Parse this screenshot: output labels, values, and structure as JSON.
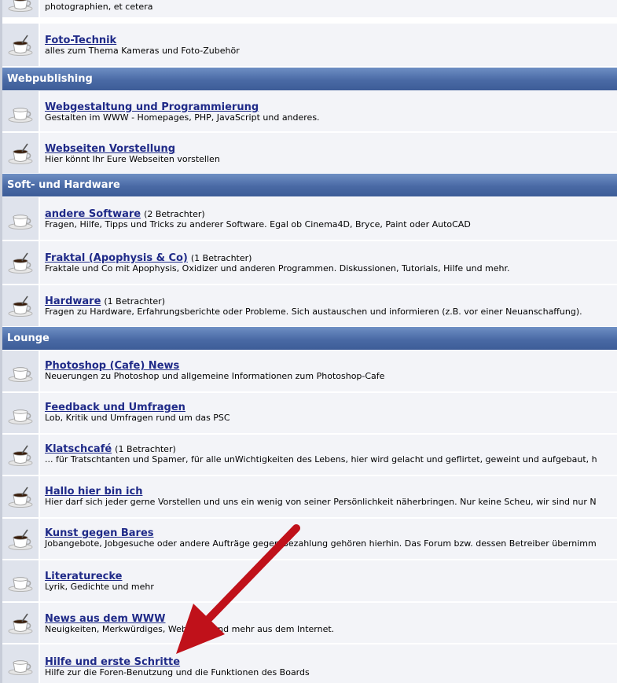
{
  "categories": [
    {
      "name": "Webpublishing"
    },
    {
      "name": "Soft- und Hardware"
    },
    {
      "name": "Lounge"
    }
  ],
  "forums": [
    {
      "title": "",
      "viewers": "",
      "desc": "photographien, et cetera",
      "icon": "cup-full-icon"
    },
    {
      "title": "Foto-Technik",
      "viewers": "",
      "desc": "alles zum Thema Kameras und Foto-Zubehör",
      "icon": "cup-full-icon"
    },
    {
      "title": "Webgestaltung und Programmierung",
      "viewers": "",
      "desc": "Gestalten im WWW - Homepages, PHP, JavaScript und anderes.",
      "icon": "cup-empty-icon"
    },
    {
      "title": "Webseiten Vorstellung",
      "viewers": "",
      "desc": "Hier könnt Ihr Eure Webseiten vorstellen",
      "icon": "cup-full-icon"
    },
    {
      "title": "andere Software",
      "viewers": "(2 Betrachter)",
      "desc": "Fragen, Hilfe, Tipps und Tricks zu anderer Software. Egal ob Cinema4D, Bryce, Paint oder AutoCAD",
      "icon": "cup-empty-icon"
    },
    {
      "title": "Fraktal (Apophysis & Co)",
      "viewers": "(1 Betrachter)",
      "desc": "Fraktale und Co mit Apophysis, Oxidizer und anderen Programmen. Diskussionen, Tutorials, Hilfe und mehr.",
      "icon": "cup-full-icon"
    },
    {
      "title": "Hardware",
      "viewers": "(1 Betrachter)",
      "desc": "Fragen zu Hardware, Erfahrungsberichte oder Probleme. Sich austauschen und informieren (z.B. vor einer Neuanschaffung).",
      "icon": "cup-full-icon"
    },
    {
      "title": "Photoshop (Cafe) News",
      "viewers": "",
      "desc": "Neuerungen zu Photoshop und allgemeine Informationen zum Photoshop-Cafe",
      "icon": "cup-empty-icon"
    },
    {
      "title": "Feedback und Umfragen",
      "viewers": "",
      "desc": "Lob, Kritik und Umfragen rund um das PSC",
      "icon": "cup-empty-icon"
    },
    {
      "title": "Klatschcafé",
      "viewers": "(1 Betrachter)",
      "desc": "... für Tratschtanten und Spamer, für alle unWichtigkeiten des Lebens, hier wird gelacht und geflirtet, geweint und aufgebaut, h",
      "icon": "cup-full-icon"
    },
    {
      "title": "Hallo hier bin ich",
      "viewers": "",
      "desc": "Hier darf sich jeder gerne Vorstellen und uns ein wenig von seiner Persönlichkeit näherbringen. Nur keine Scheu, wir sind nur N",
      "icon": "cup-full-icon"
    },
    {
      "title": "Kunst gegen Bares",
      "viewers": "",
      "desc": "Jobangebote, Jobgesuche oder andere Aufträge gegen Bezahlung gehören hierhin. Das Forum bzw. dessen Betreiber übernimm",
      "icon": "cup-full-icon"
    },
    {
      "title": "Literaturecke",
      "viewers": "",
      "desc": "Lyrik, Gedichte und mehr",
      "icon": "cup-empty-icon"
    },
    {
      "title": "News aus dem WWW",
      "viewers": "",
      "desc": "Neuigkeiten, Merkwürdiges, Webfarbe und mehr aus dem Internet.",
      "icon": "cup-full-icon"
    },
    {
      "title": "Hilfe und erste Schritte",
      "viewers": "",
      "desc": "Hilfe zur die Foren-Benutzung und die Funktionen des Boards",
      "icon": "cup-empty-icon"
    }
  ],
  "colors": {
    "category_bg": "#4a6aa5",
    "link": "#1f2a88",
    "icon_cell": "#dfe3ec",
    "row_bg": "#f3f4f8",
    "arrow": "#c0111a"
  }
}
